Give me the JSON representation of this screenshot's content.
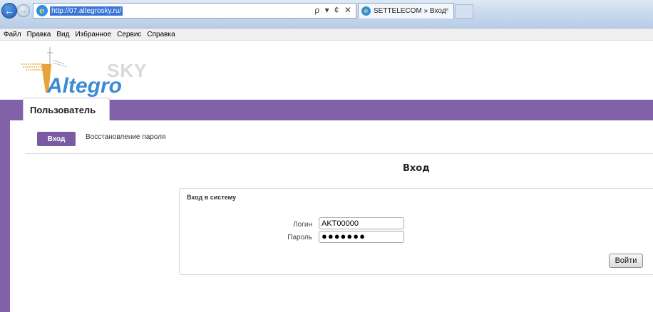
{
  "browser": {
    "url": "http://07.altegrosky.ru/",
    "address_tools": "ρ ▾ ¢ ✕",
    "tab_title": "SETTELECOM » Вход",
    "tab_close": "×"
  },
  "menu": [
    "Файл",
    "Правка",
    "Вид",
    "Избранное",
    "Сервис",
    "Справка"
  ],
  "logo": {
    "main": "Altegro",
    "sky": "SKY"
  },
  "user_tab": "Пользователь",
  "subnav": {
    "login": "Вход",
    "restore": "Восстановление пароля"
  },
  "page_title": "Вход",
  "form": {
    "header": "Вход в систему",
    "login_label": "Логин",
    "login_value": "AKT00000",
    "password_label": "Пароль",
    "password_value": "●●●●●●●",
    "submit": "Войти"
  },
  "colors": {
    "purple": "#8162a8",
    "logo_blue": "#3d8ad6",
    "sky_gray": "#d9d9d9"
  }
}
